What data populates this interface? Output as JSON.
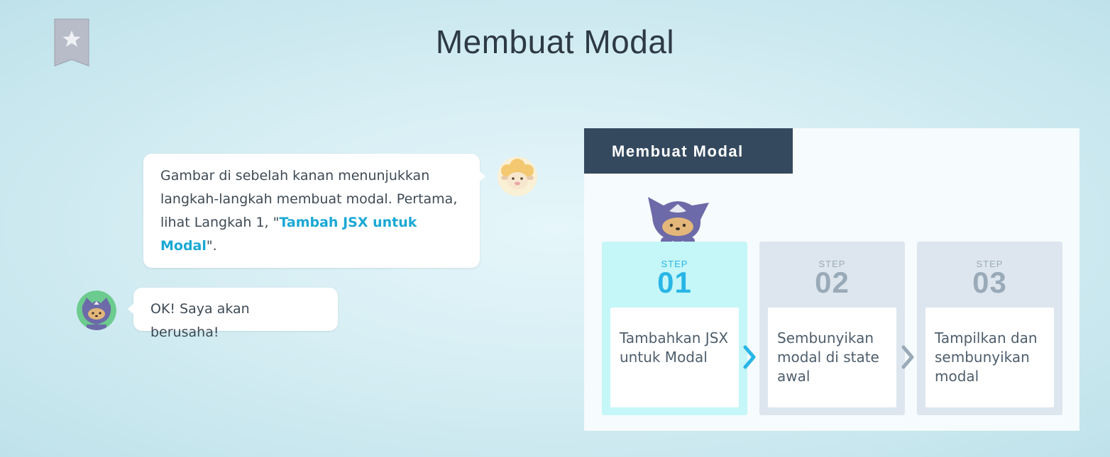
{
  "page": {
    "title": "Membuat Modal"
  },
  "chat": {
    "message_1": {
      "text_before": "Gambar di sebelah kanan menunjukkan langkah-langkah membuat modal. Pertama, lihat Langkah 1, \"",
      "highlight": "Tambah JSX untuk Modal",
      "text_after": "\"."
    },
    "message_2": {
      "text": "OK! Saya akan berusaha!"
    }
  },
  "slide": {
    "header": "Membuat Modal",
    "steps": [
      {
        "label": "STEP",
        "number": "01",
        "text": "Tambahkan JSX untuk Modal",
        "active": true
      },
      {
        "label": "STEP",
        "number": "02",
        "text": "Sembunyikan modal di state awal",
        "active": false
      },
      {
        "label": "STEP",
        "number": "03",
        "text": "Tampilkan dan sembunyikan modal",
        "active": false
      }
    ]
  },
  "colors": {
    "accent": "#1aa8d4",
    "header_bg": "#34495e",
    "active_step_bg": "#c5f6f8",
    "inactive_step_bg": "#dde6ee"
  },
  "icons": [
    "bookmark-star-icon",
    "sheep-avatar-icon",
    "ninja-avatar-icon",
    "ninja-mascot-icon",
    "chevron-right-icon"
  ]
}
